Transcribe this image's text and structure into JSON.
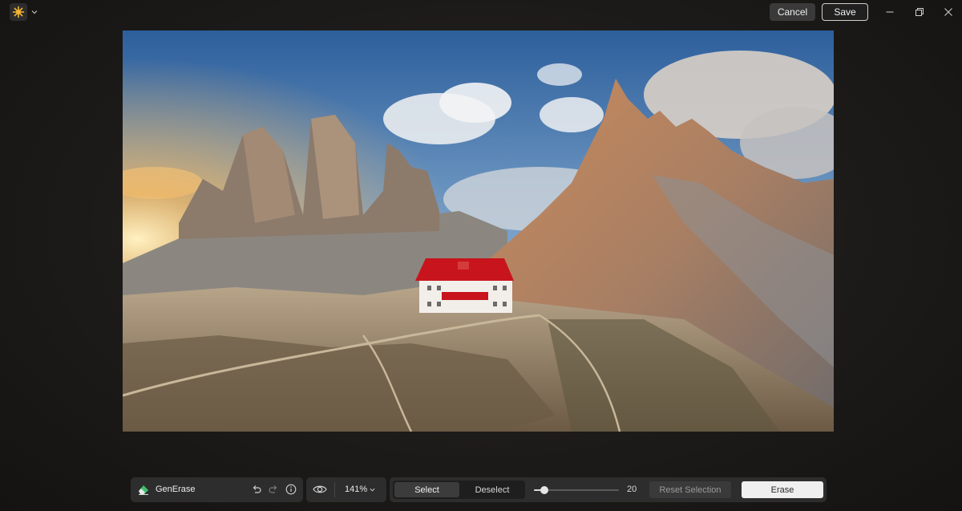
{
  "titlebar": {
    "app_icon": "sun-logo-icon",
    "cancel_label": "Cancel",
    "save_label": "Save",
    "window_controls": [
      "minimize-icon",
      "restore-icon",
      "close-icon"
    ]
  },
  "canvas": {
    "image_subject": "mountain-hut-photo"
  },
  "toolbar": {
    "tool_icon": "eraser-icon",
    "tool_name": "GenErase",
    "undo_icon": "undo-icon",
    "redo_icon": "redo-icon",
    "info_icon": "info-icon",
    "eye_icon": "eye-icon",
    "zoom_label": "141%",
    "select_label": "Select",
    "deselect_label": "Deselect",
    "brush_size": "20",
    "brush_fraction": 0.12,
    "reset_label": "Reset Selection",
    "erase_label": "Erase"
  },
  "colors": {
    "accent": "#f5b731",
    "erase_button": "#efefef",
    "eraser_icon": "#3fbf6e"
  }
}
